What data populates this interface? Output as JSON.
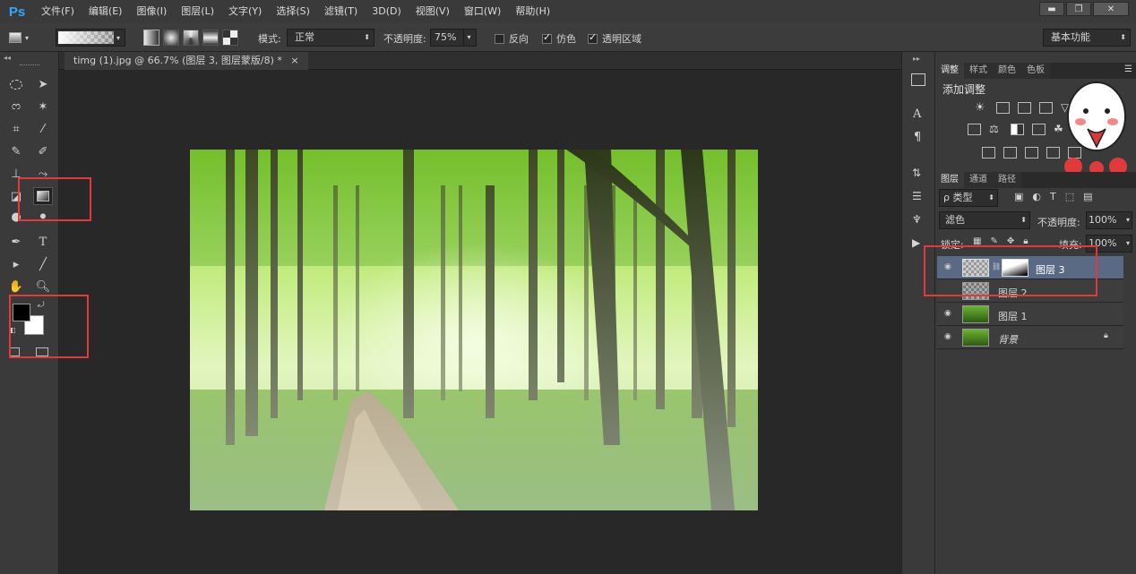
{
  "app": {
    "logo": "Ps"
  },
  "menu": [
    "文件(F)",
    "编辑(E)",
    "图像(I)",
    "图层(L)",
    "文字(Y)",
    "选择(S)",
    "滤镜(T)",
    "3D(D)",
    "视图(V)",
    "窗口(W)",
    "帮助(H)"
  ],
  "window_controls": {
    "minimize": "▬",
    "restore": "❐",
    "close": "✕"
  },
  "options": {
    "mode_label": "模式:",
    "mode_value": "正常",
    "opacity_label": "不透明度:",
    "opacity_value": "75%",
    "reverse_label": "反向",
    "reverse_checked": false,
    "dither_label": "仿色",
    "dither_checked": true,
    "transparency_label": "透明区域",
    "transparency_checked": true,
    "workspace": "基本功能"
  },
  "document": {
    "tab_title": "timg (1).jpg @ 66.7% (图层 3, 图层蒙版/8) *",
    "tab_close": "×"
  },
  "toolbar": {
    "icons": [
      "marquee-icon",
      "move-icon",
      "lasso-icon",
      "magic-wand-icon",
      "crop-icon",
      "eyedropper-icon",
      "healing-brush-icon",
      "brush-icon",
      "clone-stamp-icon",
      "history-brush-icon",
      "eraser-icon",
      "gradient-icon",
      "blur-icon",
      "dodge-icon",
      "pen-icon",
      "type-icon",
      "path-select-icon",
      "line-icon",
      "hand-icon",
      "zoom-icon"
    ],
    "type_tool_glyph": "T",
    "foreground_color": "#000000",
    "background_color": "#ffffff"
  },
  "adjustments_panel": {
    "tabs": [
      "调整",
      "样式",
      "颜色",
      "色板"
    ],
    "active_tab": "调整",
    "title": "添加调整"
  },
  "layers_panel": {
    "tabs": [
      "图层",
      "通道",
      "路径"
    ],
    "active_tab": "图层",
    "filter_label": "ρ 类型",
    "filter_icon_glyphs": [
      "T"
    ],
    "blend_mode": "滤色",
    "opacity_label": "不透明度:",
    "opacity_value": "100%",
    "lock_label": "锁定:",
    "fill_label": "填充:",
    "fill_value": "100%",
    "layers": [
      {
        "name": "图层 3",
        "visible": true,
        "selected": true,
        "has_mask": true
      },
      {
        "name": "图层 2",
        "visible": false,
        "selected": false,
        "has_mask": false
      },
      {
        "name": "图层 1",
        "visible": true,
        "selected": false,
        "has_mask": false
      },
      {
        "name": "背景",
        "visible": true,
        "selected": false,
        "locked": true
      }
    ]
  },
  "strip_icons": {
    "char_a": "A",
    "para": "¶"
  },
  "colors": {
    "accent": "#31a8ff",
    "highlight_box": "#e23a3a",
    "selected_layer": "#5a6a85"
  }
}
